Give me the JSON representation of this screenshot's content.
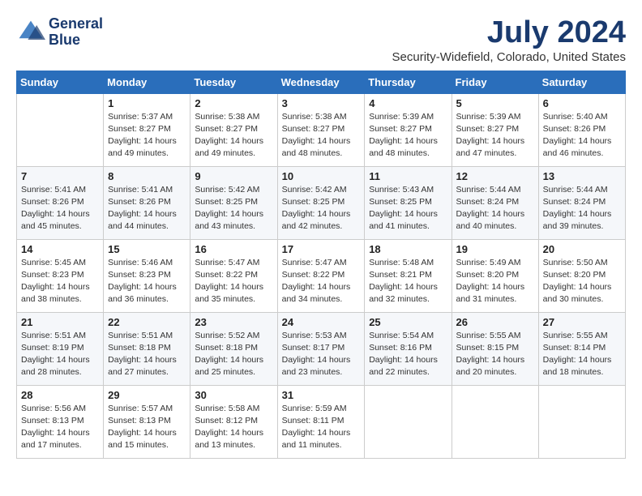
{
  "logo": {
    "line1": "General",
    "line2": "Blue"
  },
  "title": "July 2024",
  "location": "Security-Widefield, Colorado, United States",
  "days_of_week": [
    "Sunday",
    "Monday",
    "Tuesday",
    "Wednesday",
    "Thursday",
    "Friday",
    "Saturday"
  ],
  "weeks": [
    [
      {
        "day": "",
        "info": ""
      },
      {
        "day": "1",
        "info": "Sunrise: 5:37 AM\nSunset: 8:27 PM\nDaylight: 14 hours\nand 49 minutes."
      },
      {
        "day": "2",
        "info": "Sunrise: 5:38 AM\nSunset: 8:27 PM\nDaylight: 14 hours\nand 49 minutes."
      },
      {
        "day": "3",
        "info": "Sunrise: 5:38 AM\nSunset: 8:27 PM\nDaylight: 14 hours\nand 48 minutes."
      },
      {
        "day": "4",
        "info": "Sunrise: 5:39 AM\nSunset: 8:27 PM\nDaylight: 14 hours\nand 48 minutes."
      },
      {
        "day": "5",
        "info": "Sunrise: 5:39 AM\nSunset: 8:27 PM\nDaylight: 14 hours\nand 47 minutes."
      },
      {
        "day": "6",
        "info": "Sunrise: 5:40 AM\nSunset: 8:26 PM\nDaylight: 14 hours\nand 46 minutes."
      }
    ],
    [
      {
        "day": "7",
        "info": "Sunrise: 5:41 AM\nSunset: 8:26 PM\nDaylight: 14 hours\nand 45 minutes."
      },
      {
        "day": "8",
        "info": "Sunrise: 5:41 AM\nSunset: 8:26 PM\nDaylight: 14 hours\nand 44 minutes."
      },
      {
        "day": "9",
        "info": "Sunrise: 5:42 AM\nSunset: 8:25 PM\nDaylight: 14 hours\nand 43 minutes."
      },
      {
        "day": "10",
        "info": "Sunrise: 5:42 AM\nSunset: 8:25 PM\nDaylight: 14 hours\nand 42 minutes."
      },
      {
        "day": "11",
        "info": "Sunrise: 5:43 AM\nSunset: 8:25 PM\nDaylight: 14 hours\nand 41 minutes."
      },
      {
        "day": "12",
        "info": "Sunrise: 5:44 AM\nSunset: 8:24 PM\nDaylight: 14 hours\nand 40 minutes."
      },
      {
        "day": "13",
        "info": "Sunrise: 5:44 AM\nSunset: 8:24 PM\nDaylight: 14 hours\nand 39 minutes."
      }
    ],
    [
      {
        "day": "14",
        "info": "Sunrise: 5:45 AM\nSunset: 8:23 PM\nDaylight: 14 hours\nand 38 minutes."
      },
      {
        "day": "15",
        "info": "Sunrise: 5:46 AM\nSunset: 8:23 PM\nDaylight: 14 hours\nand 36 minutes."
      },
      {
        "day": "16",
        "info": "Sunrise: 5:47 AM\nSunset: 8:22 PM\nDaylight: 14 hours\nand 35 minutes."
      },
      {
        "day": "17",
        "info": "Sunrise: 5:47 AM\nSunset: 8:22 PM\nDaylight: 14 hours\nand 34 minutes."
      },
      {
        "day": "18",
        "info": "Sunrise: 5:48 AM\nSunset: 8:21 PM\nDaylight: 14 hours\nand 32 minutes."
      },
      {
        "day": "19",
        "info": "Sunrise: 5:49 AM\nSunset: 8:20 PM\nDaylight: 14 hours\nand 31 minutes."
      },
      {
        "day": "20",
        "info": "Sunrise: 5:50 AM\nSunset: 8:20 PM\nDaylight: 14 hours\nand 30 minutes."
      }
    ],
    [
      {
        "day": "21",
        "info": "Sunrise: 5:51 AM\nSunset: 8:19 PM\nDaylight: 14 hours\nand 28 minutes."
      },
      {
        "day": "22",
        "info": "Sunrise: 5:51 AM\nSunset: 8:18 PM\nDaylight: 14 hours\nand 27 minutes."
      },
      {
        "day": "23",
        "info": "Sunrise: 5:52 AM\nSunset: 8:18 PM\nDaylight: 14 hours\nand 25 minutes."
      },
      {
        "day": "24",
        "info": "Sunrise: 5:53 AM\nSunset: 8:17 PM\nDaylight: 14 hours\nand 23 minutes."
      },
      {
        "day": "25",
        "info": "Sunrise: 5:54 AM\nSunset: 8:16 PM\nDaylight: 14 hours\nand 22 minutes."
      },
      {
        "day": "26",
        "info": "Sunrise: 5:55 AM\nSunset: 8:15 PM\nDaylight: 14 hours\nand 20 minutes."
      },
      {
        "day": "27",
        "info": "Sunrise: 5:55 AM\nSunset: 8:14 PM\nDaylight: 14 hours\nand 18 minutes."
      }
    ],
    [
      {
        "day": "28",
        "info": "Sunrise: 5:56 AM\nSunset: 8:13 PM\nDaylight: 14 hours\nand 17 minutes."
      },
      {
        "day": "29",
        "info": "Sunrise: 5:57 AM\nSunset: 8:13 PM\nDaylight: 14 hours\nand 15 minutes."
      },
      {
        "day": "30",
        "info": "Sunrise: 5:58 AM\nSunset: 8:12 PM\nDaylight: 14 hours\nand 13 minutes."
      },
      {
        "day": "31",
        "info": "Sunrise: 5:59 AM\nSunset: 8:11 PM\nDaylight: 14 hours\nand 11 minutes."
      },
      {
        "day": "",
        "info": ""
      },
      {
        "day": "",
        "info": ""
      },
      {
        "day": "",
        "info": ""
      }
    ]
  ]
}
